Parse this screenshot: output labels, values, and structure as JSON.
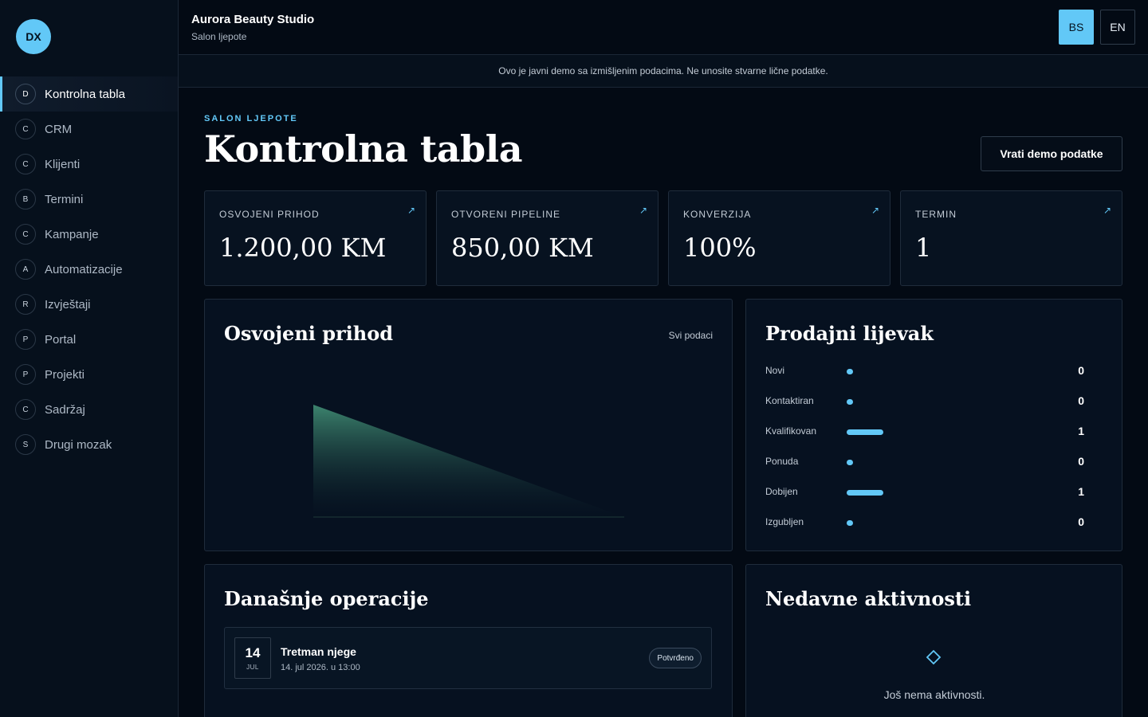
{
  "logo": "DX",
  "nav": [
    {
      "badge": "D",
      "label": "Kontrolna tabla"
    },
    {
      "badge": "C",
      "label": "CRM"
    },
    {
      "badge": "C",
      "label": "Klijenti"
    },
    {
      "badge": "B",
      "label": "Termini"
    },
    {
      "badge": "C",
      "label": "Kampanje"
    },
    {
      "badge": "A",
      "label": "Automatizacije"
    },
    {
      "badge": "R",
      "label": "Izvještaji"
    },
    {
      "badge": "P",
      "label": "Portal"
    },
    {
      "badge": "P",
      "label": "Projekti"
    },
    {
      "badge": "C",
      "label": "Sadržaj"
    },
    {
      "badge": "S",
      "label": "Drugi mozak"
    }
  ],
  "header": {
    "title": "Aurora Beauty Studio",
    "subtitle": "Salon ljepote",
    "lang": {
      "bs": "BS",
      "en": "EN",
      "active": "BS"
    }
  },
  "notice": "Ovo je javni demo sa izmišljenim podacima. Ne unosite stvarne lične podatke.",
  "page": {
    "eyebrow": "SALON LJEPOTE",
    "title": "Kontrolna tabla",
    "reset_button": "Vrati demo podatke"
  },
  "kpis": [
    {
      "label": "OSVOJENI PRIHOD",
      "value": "1.200,00 KM",
      "arrow": "↗"
    },
    {
      "label": "OTVORENI PIPELINE",
      "value": "850,00 KM",
      "arrow": "↗"
    },
    {
      "label": "KONVERZIJA",
      "value": "100%",
      "arrow": "↗"
    },
    {
      "label": "TERMIN",
      "value": "1",
      "arrow": "↗"
    }
  ],
  "revenue_card": {
    "title": "Osvojeni prihod",
    "filter": "Svi podaci"
  },
  "chart_data": {
    "type": "area",
    "x": [
      0,
      1
    ],
    "values": [
      1200,
      0
    ],
    "colors": {
      "fill_top": "#3f8a72",
      "fill_bottom": "#061120",
      "axis": "#1f3a3a"
    }
  },
  "funnel": {
    "title": "Prodajni lijevak",
    "max": 1,
    "stages": [
      {
        "label": "Novi",
        "count": 0
      },
      {
        "label": "Kontaktiran",
        "count": 0
      },
      {
        "label": "Kvalifikovan",
        "count": 1
      },
      {
        "label": "Ponuda",
        "count": 0
      },
      {
        "label": "Dobijen",
        "count": 1
      },
      {
        "label": "Izgubljen",
        "count": 0
      }
    ]
  },
  "operations": {
    "title": "Današnje operacije",
    "items": [
      {
        "day": "14",
        "month": "JUL",
        "title": "Tretman njege",
        "time": "14. jul 2026. u 13:00",
        "status": "Potvrđeno"
      }
    ]
  },
  "activity": {
    "title": "Nedavne aktivnosti",
    "empty_text": "Još nema aktivnosti.",
    "empty_icon": "diamond-icon"
  },
  "colors": {
    "accent": "#62c8f7",
    "background": "#030a14",
    "card": "#061120"
  }
}
